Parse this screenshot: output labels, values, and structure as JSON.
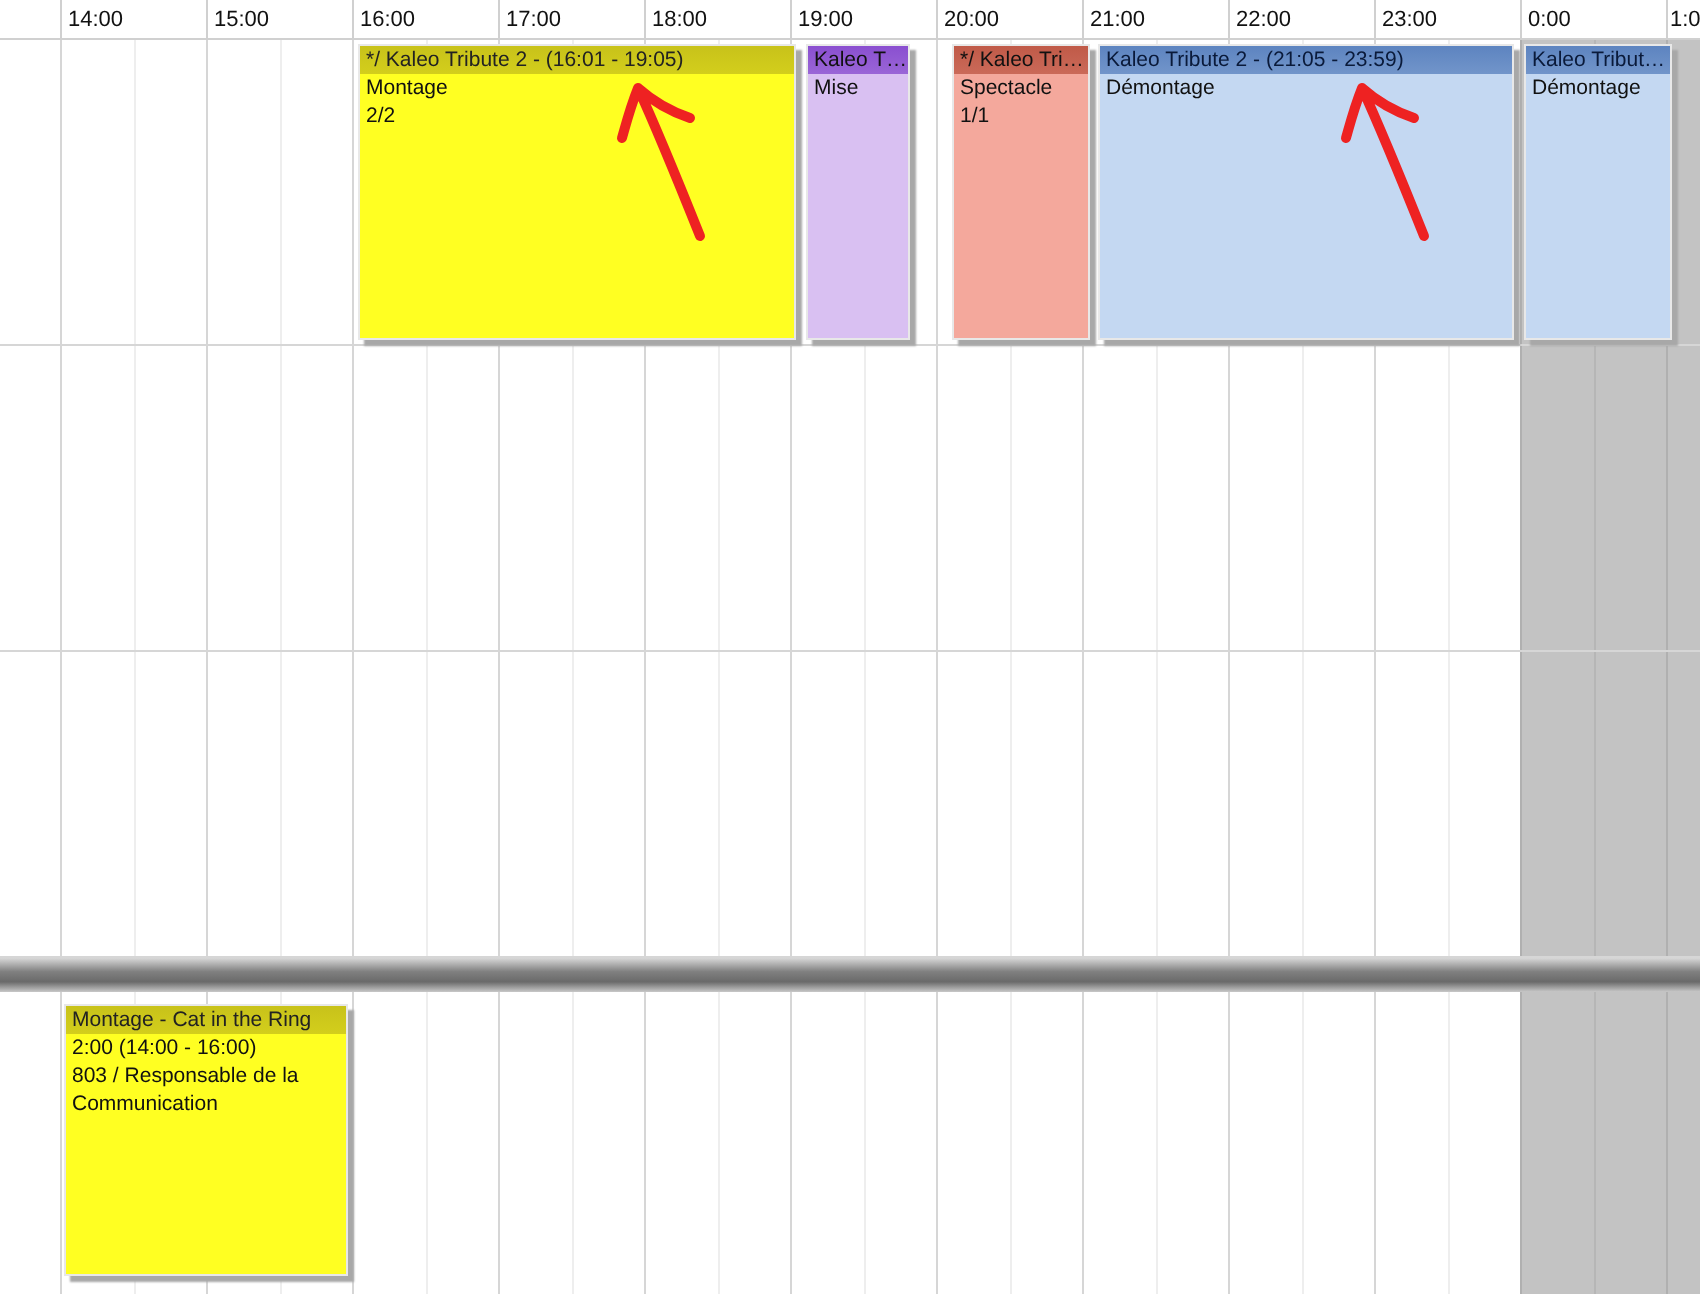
{
  "hours": [
    "14:00",
    "15:00",
    "16:00",
    "17:00",
    "18:00",
    "19:00",
    "20:00",
    "21:00",
    "22:00",
    "23:00",
    "0:00",
    "1:0"
  ],
  "events": [
    {
      "title": "*/ Kaleo Tribute 2 -  (16:01 - 19:05)",
      "lines": [
        "Montage",
        "2/2"
      ],
      "color": "#ffff22"
    },
    {
      "title": "Kaleo T…",
      "lines": [
        "Mise"
      ],
      "color": "#d9c0f2"
    },
    {
      "title": "*/ Kaleo Tri…",
      "lines": [
        "Spectacle",
        "1/1"
      ],
      "color": "#f4a89c"
    },
    {
      "title": "Kaleo Tribute 2 -  (21:05 - 23:59)",
      "lines": [
        "Démontage"
      ],
      "color": "#c4d8f2"
    },
    {
      "title": "Kaleo Tribut…",
      "lines": [
        "Démontage"
      ],
      "color": "#c4d8f2"
    },
    {
      "title": "Montage - Cat in the Ring",
      "lines": [
        "2:00 (14:00 - 16:00)",
        "803 / Responsable de la Communication"
      ],
      "color": "#ffff22"
    }
  ]
}
